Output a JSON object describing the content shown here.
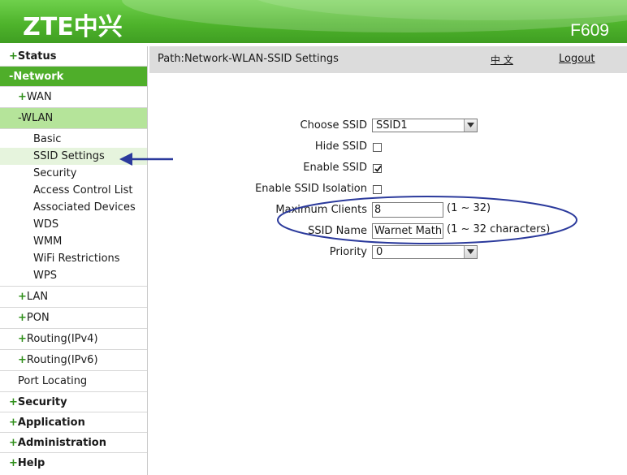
{
  "header": {
    "logo": "ZTE中兴",
    "model": "F609"
  },
  "sidebar": {
    "status": "Status",
    "network": "Network",
    "wan": "WAN",
    "wlan": "WLAN",
    "wlan_items": [
      "Basic",
      "SSID Settings",
      "Security",
      "Access Control List",
      "Associated Devices",
      "WDS",
      "WMM",
      "WiFi Restrictions",
      "WPS"
    ],
    "lan": "LAN",
    "pon": "PON",
    "routing_v4": "Routing(IPv4)",
    "routing_v6": "Routing(IPv6)",
    "port_locating": "Port Locating",
    "security": "Security",
    "application": "Application",
    "administration": "Administration",
    "help": "Help"
  },
  "topbar": {
    "path": "Path:Network-WLAN-SSID Settings",
    "lang": "中 文",
    "logout": "Logout"
  },
  "form": {
    "choose_ssid_label": "Choose SSID",
    "choose_ssid_value": "SSID1",
    "hide_ssid_label": "Hide SSID",
    "hide_ssid_checked": false,
    "enable_ssid_label": "Enable SSID",
    "enable_ssid_checked": true,
    "isolation_label": "Enable SSID Isolation",
    "isolation_checked": false,
    "max_clients_label": "Maximum Clients",
    "max_clients_value": "8",
    "max_clients_hint": "(1 ~ 32)",
    "ssid_name_label": "SSID Name",
    "ssid_name_value": "Warnet Mathl",
    "ssid_name_hint": "(1 ~ 32 characters)",
    "priority_label": "Priority",
    "priority_value": "0"
  },
  "colors": {
    "header_green": "#4fb42c",
    "nav_active": "#4fae2a",
    "nav_sub_active": "#b5e49a",
    "annotation": "#2b3a9c"
  }
}
